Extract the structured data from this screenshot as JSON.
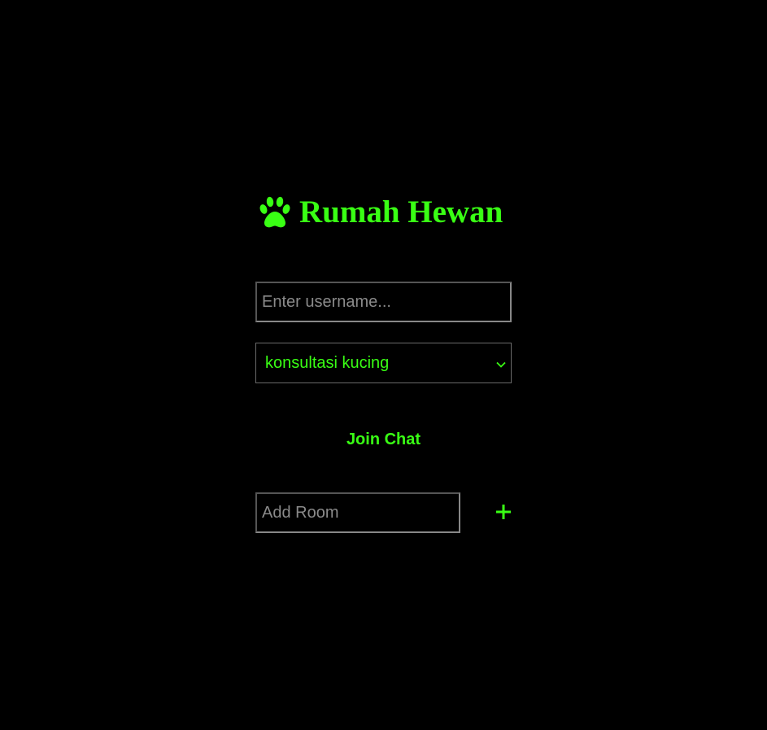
{
  "app": {
    "title": "Rumah Hewan",
    "icons": {
      "logo": "paw-icon",
      "add": "plus-icon",
      "select": "chevron-down-icon"
    },
    "colors": {
      "accent": "#39ff14",
      "background": "#000000",
      "placeholder": "#8a8a8a"
    }
  },
  "form": {
    "username_placeholder": "Enter username...",
    "username_value": "",
    "room_select_value": "konsultasi kucing",
    "join_label": "Join Chat",
    "add_room_placeholder": "Add Room",
    "add_room_value": "",
    "add_room_button": "+"
  }
}
